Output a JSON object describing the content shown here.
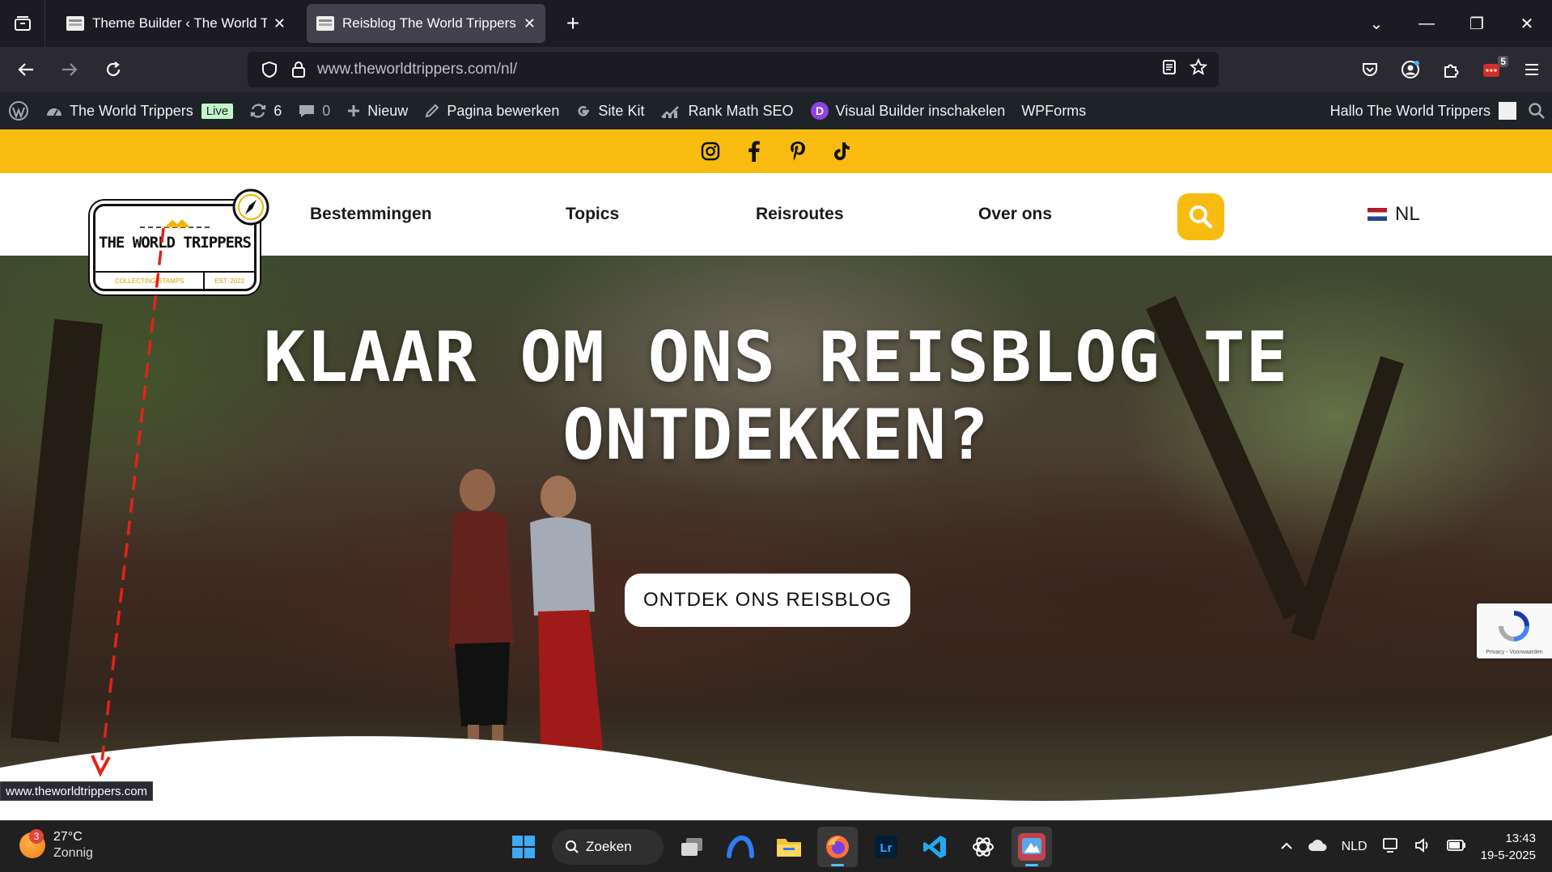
{
  "browser": {
    "tabs": [
      {
        "title": "Theme Builder ‹ The World Tripp",
        "active": false
      },
      {
        "title": "Reisblog The World Trippers. Vo",
        "active": true
      }
    ],
    "url_host": "www.theworldtrippers.com",
    "url_path": "/nl/",
    "extension_badge": "5"
  },
  "wpbar": {
    "site_name": "The World Trippers",
    "live_label": "Live",
    "updates_count": "6",
    "comments_count": "0",
    "new_label": "Nieuw",
    "edit_page_label": "Pagina bewerken",
    "site_kit_label": "Site Kit",
    "rank_math_label": "Rank Math SEO",
    "visual_builder_label": "Visual Builder inschakelen",
    "wpforms_label": "WPForms",
    "greeting": "Hallo The World Trippers"
  },
  "site": {
    "logo": {
      "name": "THE WORLD TRIPPERS",
      "left_band": "COLLECTING STAMPS",
      "right_band": "EST. 2022"
    },
    "menu": [
      {
        "label": "Bestemmingen"
      },
      {
        "label": "Topics"
      },
      {
        "label": "Reisroutes"
      },
      {
        "label": "Over ons"
      }
    ],
    "language": "NL",
    "headline_line1": "KLAAR OM ONS REISBLOG TE",
    "headline_line2": "ONTDEKKEN?",
    "cta_label": "ONTDEK ONS REISBLOG",
    "recaptcha_text": "Privacy - Voorwaarden",
    "accent_color": "#f8bc10"
  },
  "status_url": "www.theworldtrippers.com",
  "taskbar": {
    "weather_badge": "3",
    "temperature": "27°C",
    "condition": "Zonnig",
    "search_label": "Zoeken",
    "language": "NLD",
    "time": "13:43",
    "date": "19-5-2025"
  }
}
